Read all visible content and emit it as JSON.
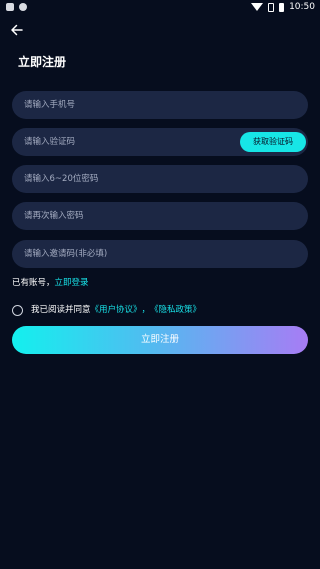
{
  "status_bar": {
    "time": "10:50"
  },
  "header": {
    "title": "立即注册"
  },
  "form": {
    "phone_placeholder": "请输入手机号",
    "code_placeholder": "请输入验证码",
    "get_code_label": "获取验证码",
    "password_placeholder": "请输入6~20位密码",
    "confirm_placeholder": "请再次输入密码",
    "invite_placeholder": "请输入邀请码(非必填)"
  },
  "login_prompt": {
    "text": "已有账号，",
    "link": "立即登录"
  },
  "agreement": {
    "prefix": "我已阅读并同意",
    "user_agreement": "《用户协议》",
    "separator": "，",
    "privacy_policy": "《隐私政策》"
  },
  "submit_label": "立即注册"
}
